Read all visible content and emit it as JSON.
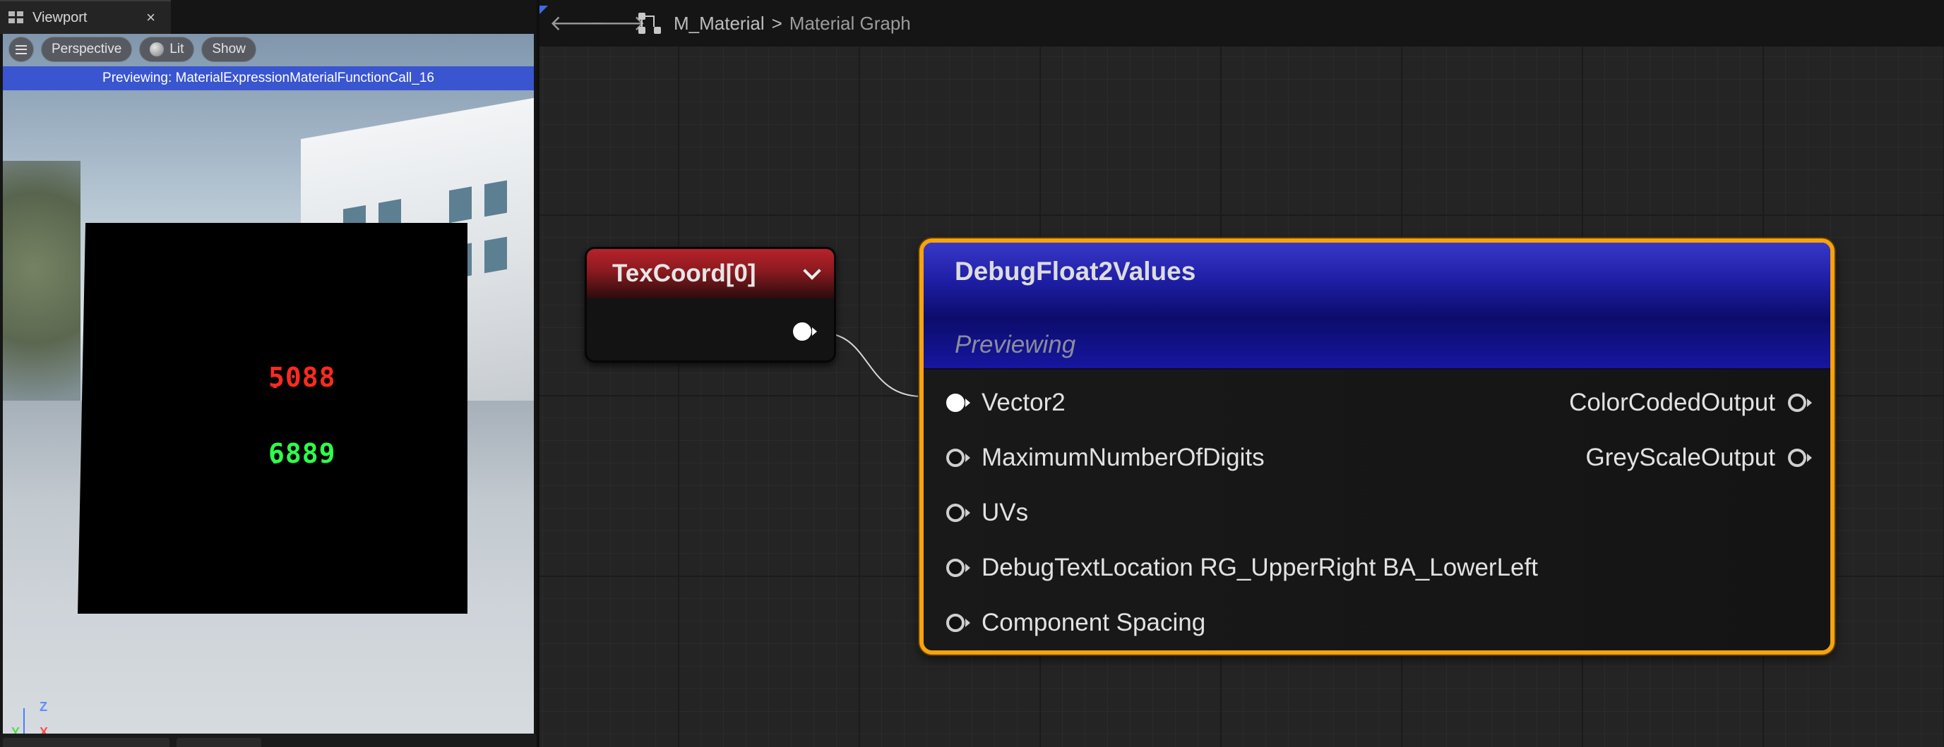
{
  "viewport": {
    "tab_label": "Viewport",
    "close_glyph": "×",
    "toolbar": {
      "menu_icon": "hamburger-menu-icon",
      "perspective_label": "Perspective",
      "lit_label": "Lit",
      "show_label": "Show"
    },
    "preview_banner": "Previewing: MaterialExpressionMaterialFunctionCall_16",
    "preview": {
      "red_digits": "5088",
      "green_digits": "6889",
      "red_color": "#ff2a1e",
      "green_color": "#2cff4a"
    },
    "axis": {
      "z": "Z",
      "x": "X",
      "y": "Y"
    }
  },
  "graph": {
    "back_icon": "arrow-left-icon",
    "forward_icon": "arrow-right-icon",
    "back_glyph": "🡐",
    "forward_glyph": "🡒",
    "breadcrumb": {
      "asset": "M_Material",
      "separator": ">",
      "current": "Material Graph"
    },
    "nodes": {
      "texcoord": {
        "title": "TexCoord[0]",
        "header_color": "#b8222b"
      },
      "debug": {
        "title": "DebugFloat2Values",
        "subtitle": "Previewing",
        "header_color": "#1e1ea6",
        "selection_color": "#f5a30f",
        "inputs": [
          "Vector2",
          "MaximumNumberOfDigits",
          "UVs",
          "DebugTextLocation RG_UpperRight BA_LowerLeft",
          "Component Spacing"
        ],
        "outputs": [
          "ColorCodedOutput",
          "GreyScaleOutput"
        ]
      }
    }
  }
}
